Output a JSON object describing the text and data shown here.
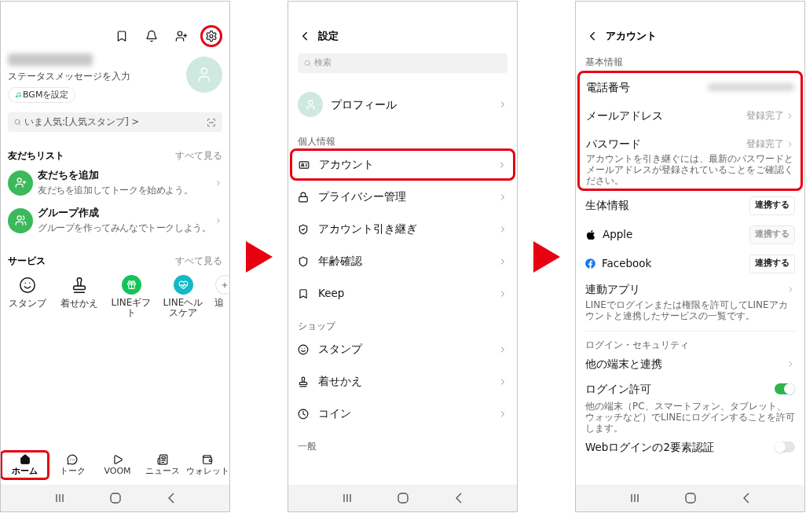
{
  "home": {
    "top_icons": [
      {
        "kind": "bookmark",
        "highlighted": false
      },
      {
        "kind": "bell",
        "highlighted": false
      },
      {
        "kind": "add-friend",
        "highlighted": false
      },
      {
        "kind": "settings",
        "highlighted": true
      }
    ],
    "status_message": "ステータスメッセージを入力",
    "bgm_button": "BGMを設定",
    "search": {
      "placeholder": "いま人気:[人気スタンプ] >"
    },
    "friends": {
      "title": "友だちリスト",
      "see_all": "すべて見る",
      "items": [
        {
          "kind": "add",
          "title": "友だちを追加",
          "subtitle": "友だちを追加してトークを始めよう。"
        },
        {
          "kind": "group",
          "title": "グループ作成",
          "subtitle": "グループを作ってみんなでトークしよう。"
        }
      ]
    },
    "services": {
      "title": "サービス",
      "see_all": "すべて見る",
      "items": [
        {
          "kind": "smile",
          "label": "スタンプ"
        },
        {
          "kind": "stamp",
          "label": "着せかえ"
        },
        {
          "kind": "gift",
          "label": "LINEギフト"
        },
        {
          "kind": "health",
          "label": "LINEヘルスケア"
        },
        {
          "kind": "more",
          "label": "追"
        }
      ]
    },
    "tabs": [
      {
        "kind": "home",
        "label": "ホーム",
        "selected": true,
        "highlighted": true
      },
      {
        "kind": "talk",
        "label": "トーク",
        "selected": false,
        "highlighted": false
      },
      {
        "kind": "voom",
        "label": "VOOM",
        "selected": false,
        "highlighted": false
      },
      {
        "kind": "news",
        "label": "ニュース",
        "selected": false,
        "highlighted": false
      },
      {
        "kind": "wallet",
        "label": "ウォレット",
        "selected": false,
        "highlighted": false
      }
    ]
  },
  "settings": {
    "title": "設定",
    "search": {
      "placeholder": "検索"
    },
    "profile": "プロフィール",
    "sections": [
      {
        "title": "個人情報",
        "items": [
          {
            "kind": "id-card",
            "label": "アカウント",
            "highlighted": true
          },
          {
            "kind": "lock",
            "label": "プライバシー管理",
            "highlighted": false
          },
          {
            "kind": "shield-check",
            "label": "アカウント引き継ぎ",
            "highlighted": false
          },
          {
            "kind": "shield",
            "label": "年齢確認",
            "highlighted": false
          },
          {
            "kind": "bookmark",
            "label": "Keep",
            "highlighted": false
          }
        ]
      },
      {
        "title": "ショップ",
        "items": [
          {
            "kind": "smile",
            "label": "スタンプ",
            "highlighted": false
          },
          {
            "kind": "stamp",
            "label": "着せかえ",
            "highlighted": false
          },
          {
            "kind": "clock",
            "label": "コイン",
            "highlighted": false
          }
        ]
      },
      {
        "title": "一般"
      }
    ]
  },
  "account": {
    "title": "アカウント",
    "basic_info": {
      "title": "基本情報",
      "highlighted": true,
      "items": [
        {
          "kind": "redacted",
          "label": "電話番号"
        },
        {
          "kind": "link",
          "label": "メールアドレス",
          "value": "登録完了"
        },
        {
          "kind": "link",
          "label": "パスワード",
          "value": "登録完了"
        }
      ],
      "note": "アカウントを引き継ぐには、最新のパスワードとメールアドレスが登録されていることをご確認ください。"
    },
    "links": [
      {
        "kind": "connect",
        "label": "生体情報",
        "button": "連携する",
        "disabled": false
      },
      {
        "kind": "apple",
        "label": "Apple",
        "button": "連携する",
        "disabled": true
      },
      {
        "kind": "facebook",
        "label": "Facebook",
        "button": "連携する",
        "disabled": false
      },
      {
        "kind": "link",
        "label": "連動アプリ",
        "description": "LINEでログインまたは権限を許可してLINEアカウントと連携したサービスの一覧です。"
      }
    ],
    "security": {
      "title": "ログイン・セキュリティ",
      "items": [
        {
          "kind": "link",
          "label": "他の端末と連携"
        },
        {
          "kind": "toggle",
          "label": "ログイン許可",
          "on": true,
          "description": "他の端末（PC、スマートフォン、タブレット、ウォッチなど）でLINEにログインすることを許可します。"
        },
        {
          "kind": "toggle",
          "label": "Webログインの2要素認証",
          "on": false
        }
      ]
    }
  }
}
